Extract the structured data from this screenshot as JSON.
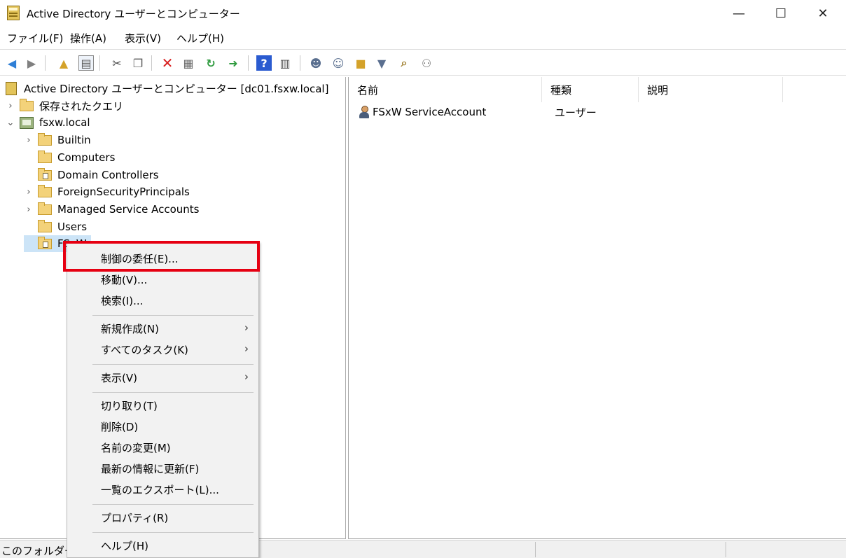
{
  "window": {
    "title": "Active Directory ユーザーとコンピューター",
    "minimize_glyph": "—",
    "maximize_glyph": "☐",
    "close_glyph": "✕"
  },
  "menubar": [
    "ファイル(F)",
    "操作(A)",
    "表示(V)",
    "ヘルプ(H)"
  ],
  "toolbar": {
    "icons": [
      "back-arrow-icon",
      "forward-arrow-icon",
      "up-folder-icon",
      "show-hide-tree-icon",
      "cut-icon",
      "copy-icon",
      "delete-icon",
      "properties-icon",
      "refresh-icon",
      "export-list-icon",
      "help-icon",
      "action-pane-icon",
      "new-user-icon",
      "new-group-icon",
      "new-ou-icon",
      "filter-icon",
      "find-icon",
      "add-to-group-icon"
    ]
  },
  "tree": {
    "root": "Active Directory ユーザーとコンピューター [dc01.fsxw.local]",
    "saved_queries": "保存されたクエリ",
    "domain": "fsxw.local",
    "containers": [
      {
        "label": "Builtin",
        "expandable": true,
        "ou": false
      },
      {
        "label": "Computers",
        "expandable": false,
        "ou": false
      },
      {
        "label": "Domain Controllers",
        "expandable": false,
        "ou": true
      },
      {
        "label": "ForeignSecurityPrincipals",
        "expandable": true,
        "ou": false
      },
      {
        "label": "Managed Service Accounts",
        "expandable": true,
        "ou": false
      },
      {
        "label": "Users",
        "expandable": false,
        "ou": false
      },
      {
        "label": "FSxW",
        "expandable": false,
        "ou": true
      }
    ]
  },
  "list": {
    "columns": [
      "名前",
      "種類",
      "説明"
    ],
    "rows": [
      {
        "name": "FSxW ServiceAccount",
        "type": "ユーザー",
        "description": ""
      }
    ]
  },
  "context_menu": {
    "items": [
      {
        "label": "制御の委任(E)...",
        "submenu": false,
        "highlighted": true
      },
      {
        "label": "移動(V)...",
        "submenu": false
      },
      {
        "label": "検索(I)...",
        "submenu": false
      },
      {
        "label": "新規作成(N)",
        "submenu": true
      },
      {
        "label": "すべてのタスク(K)",
        "submenu": true
      },
      {
        "label": "表示(V)",
        "submenu": true
      },
      {
        "label": "切り取り(T)",
        "submenu": false
      },
      {
        "label": "削除(D)",
        "submenu": false
      },
      {
        "label": "名前の変更(M)",
        "submenu": false
      },
      {
        "label": "最新の情報に更新(F)",
        "submenu": false
      },
      {
        "label": "一覧のエクスポート(L)...",
        "submenu": false
      },
      {
        "label": "プロパティ(R)",
        "submenu": false
      },
      {
        "label": "ヘルプ(H)",
        "submenu": false
      }
    ],
    "submenu_glyph": "›",
    "highlight_color": "#e60012"
  },
  "statusbar": {
    "text": "このフォルダーの"
  },
  "colors": {
    "accent_red": "#e60012",
    "folder": "#f3d27a"
  }
}
